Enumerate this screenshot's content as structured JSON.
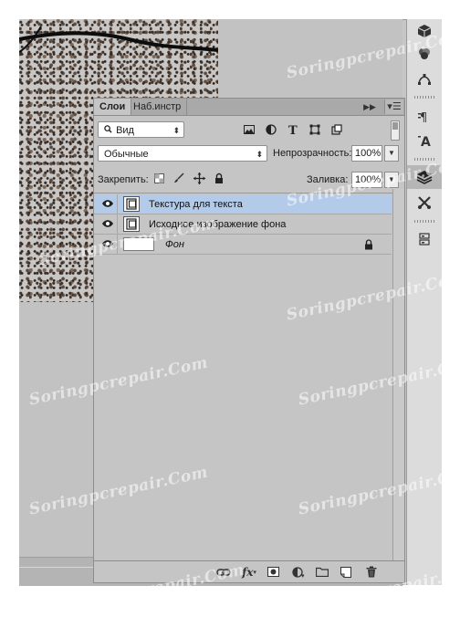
{
  "panel": {
    "tabs": [
      {
        "label": "Слои"
      },
      {
        "label": "Наб.инстр"
      }
    ],
    "collapse_icon": "double-arrow-right",
    "menu_icon": "panel-menu"
  },
  "filter": {
    "kind_label": "Вид",
    "icon": "search-icon"
  },
  "blend": {
    "mode": "Обычные",
    "opacity_label": "Непрозрачность:",
    "opacity_value": "100%"
  },
  "lock": {
    "label": "Закрепить:",
    "fill_label": "Заливка:",
    "fill_value": "100%"
  },
  "layers": [
    {
      "name": "Текстура для текста",
      "selected": true,
      "visible": true,
      "type": "smart-object"
    },
    {
      "name": "Исходное изображение фона",
      "selected": false,
      "visible": true,
      "type": "smart-object"
    },
    {
      "name": "Фон",
      "selected": false,
      "visible": true,
      "type": "background",
      "locked": true
    }
  ],
  "footer_buttons": [
    "link-layers-icon",
    "fx-icon",
    "add-mask-icon",
    "adjustment-layer-icon",
    "new-group-icon",
    "new-layer-icon",
    "trash-icon"
  ],
  "watermarks": [
    "Soringpcrepair.Com",
    "Soringpcrepair.Com",
    "Soringpcrepair.Com",
    "Soringpcrepair.Com",
    "Soringpcrepair.Com",
    "Soringpcrepair.Com",
    "Soringpcrepair.Com",
    "Soringpcrepair.Com",
    "Soringpcrepair.Com",
    "Soringpcrepair.Com"
  ],
  "fx_label": "fx",
  "colors": {
    "selected_row": "#b3cbe8",
    "panel_bg": "#c5c5c5"
  }
}
